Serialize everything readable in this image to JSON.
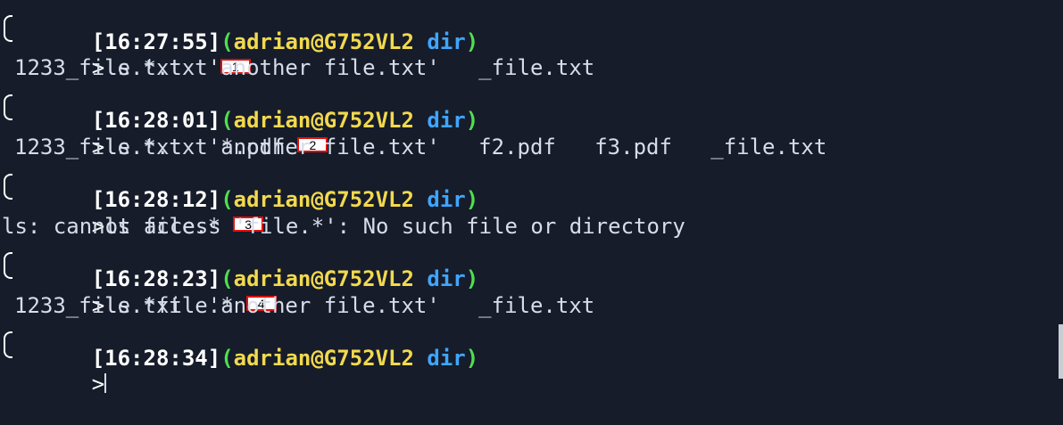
{
  "terminal": {
    "colors": {
      "background": "#161c2a",
      "user_host": "#f2d94e",
      "directory": "#3fa6ff",
      "parens": "#4ee04e",
      "text": "#d7dde8",
      "marker_border": "#e01010"
    },
    "blocks": [
      {
        "time": "[16:27:55]",
        "user_host": "adrian@G752VL2",
        "dir": "dir",
        "command": "ls *.txt",
        "marker": "1",
        "output": "1233_file.txt  'another file.txt'   _file.txt"
      },
      {
        "time": "[16:28:01]",
        "user_host": "adrian@G752VL2",
        "dir": "dir",
        "command": "ls *.txt *.pdf",
        "marker": "2",
        "output": "1233_file.txt  'another file.txt'   f2.pdf   f3.pdf   _file.txt"
      },
      {
        "time": "[16:28:12]",
        "user_host": "adrian@G752VL2",
        "dir": "dir",
        "command": "ls file.*",
        "marker": "3",
        "output": "ls: cannot access 'file.*': No such file or directory"
      },
      {
        "time": "[16:28:23]",
        "user_host": "adrian@G752VL2",
        "dir": "dir",
        "command": "ls *file.*",
        "marker": "4",
        "output": "1233_file.txt  'another file.txt'   _file.txt"
      },
      {
        "time": "[16:28:34]",
        "user_host": "adrian@G752VL2",
        "dir": "dir",
        "command": ""
      }
    ],
    "open_paren": "(",
    "close_paren": ")",
    "space": " ",
    "arrow": ">"
  }
}
